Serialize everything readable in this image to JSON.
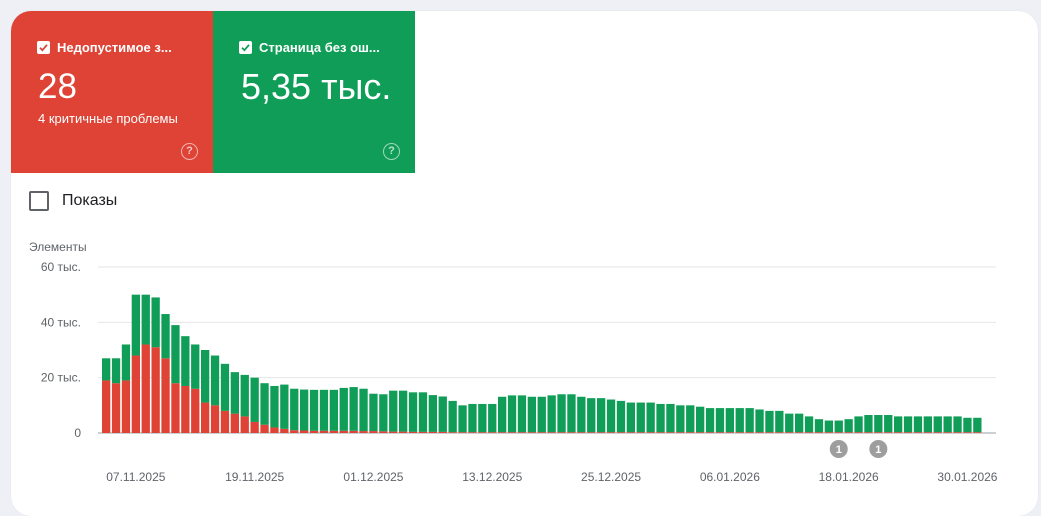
{
  "tiles": [
    {
      "label": "Недопустимое з...",
      "value": "28",
      "sub": "4 критичные проблемы",
      "color": "#de4336"
    },
    {
      "label": "Страница без ош...",
      "value": "5,35 тыс.",
      "color": "#0f9d58"
    }
  ],
  "help_icon": "help-circle-icon",
  "shows_label": "Показы",
  "chart_data": {
    "type": "bar",
    "stacked": true,
    "ylabel": "Элементы",
    "ylim": [
      0,
      60000
    ],
    "ytick_labels": [
      "0",
      "20 тыс.",
      "40 тыс.",
      "60 тыс."
    ],
    "ytick_values": [
      0,
      20000,
      40000,
      60000
    ],
    "xtick_labels": [
      "07.11.2025",
      "19.11.2025",
      "01.12.2025",
      "13.12.2025",
      "25.12.2025",
      "06.01.2026",
      "18.01.2026",
      "30.01.2026"
    ],
    "xtick_indices": [
      3,
      15,
      27,
      39,
      51,
      63,
      75,
      87
    ],
    "grid": true,
    "colors": {
      "invalid": "#de4336",
      "valid": "#0f9d58"
    },
    "series": [
      {
        "name": "Недопустимое з...",
        "values": [
          19000,
          18000,
          19000,
          28000,
          32000,
          31000,
          27000,
          18000,
          17000,
          16000,
          11000,
          10000,
          8000,
          7000,
          6000,
          4000,
          3000,
          2000,
          1500,
          1000,
          900,
          800,
          800,
          800,
          800,
          800,
          700,
          700,
          600,
          500,
          500,
          400,
          400,
          400,
          400,
          300,
          300,
          300,
          300,
          300,
          300,
          300,
          300,
          300,
          300,
          300,
          300,
          300,
          300,
          300,
          300,
          300,
          300,
          300,
          300,
          300,
          300,
          300,
          300,
          300,
          300,
          300,
          300,
          300,
          300,
          300,
          300,
          300,
          300,
          300,
          300,
          300,
          300,
          300,
          300,
          300,
          300,
          300,
          300,
          300,
          300,
          300,
          300,
          300,
          300,
          300,
          300,
          300,
          300
        ]
      },
      {
        "name": "Страница без ош...",
        "values": [
          8000,
          9000,
          13000,
          22000,
          18000,
          18000,
          16000,
          21000,
          18000,
          16000,
          19000,
          18000,
          17000,
          15000,
          15000,
          16000,
          15000,
          15000,
          16000,
          15000,
          14800,
          14800,
          14800,
          14800,
          15500,
          15800,
          15300,
          13500,
          13400,
          14800,
          14800,
          14300,
          14300,
          13300,
          12800,
          11300,
          9700,
          10200,
          10200,
          10200,
          12800,
          13300,
          13300,
          12800,
          12800,
          13300,
          13700,
          13700,
          12800,
          12300,
          12300,
          11800,
          11300,
          10700,
          10700,
          10700,
          10200,
          10200,
          9700,
          9700,
          9200,
          8700,
          8700,
          8700,
          8700,
          8700,
          8200,
          7700,
          7700,
          6700,
          6700,
          5700,
          4700,
          4200,
          4200,
          4700,
          5700,
          6200,
          6200,
          6200,
          5700,
          5700,
          5700,
          5700,
          5700,
          5700,
          5700,
          5200,
          5200
        ]
      }
    ],
    "annotations": [
      {
        "label": "1",
        "index": 74
      },
      {
        "label": "1",
        "index": 78
      }
    ]
  }
}
